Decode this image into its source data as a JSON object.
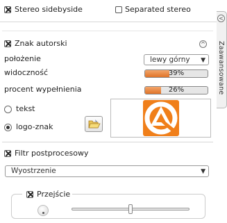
{
  "stereo": {
    "sidebyside_label": "Stereo sidebyside",
    "separated_label": "Separated stereo"
  },
  "side_tab": {
    "label": "Zaawansowane"
  },
  "watermark": {
    "title": "Znak autorski",
    "position_label": "położenie",
    "position_value": "lewy górny",
    "visibility_label": "widoczność",
    "visibility_value": "39%",
    "visibility_fraction": 0.39,
    "fill_label": "procent wypełnienia",
    "fill_value": "26%",
    "fill_fraction": 0.26,
    "text_option": "tekst",
    "logo_option": "logo-znak",
    "accent": "#f07f1a"
  },
  "postprocess": {
    "title": "Filtr postprocesowy",
    "filter_value": "Wyostrzenie"
  },
  "transition": {
    "label": "Przejście",
    "slider_fraction": 0.5
  }
}
